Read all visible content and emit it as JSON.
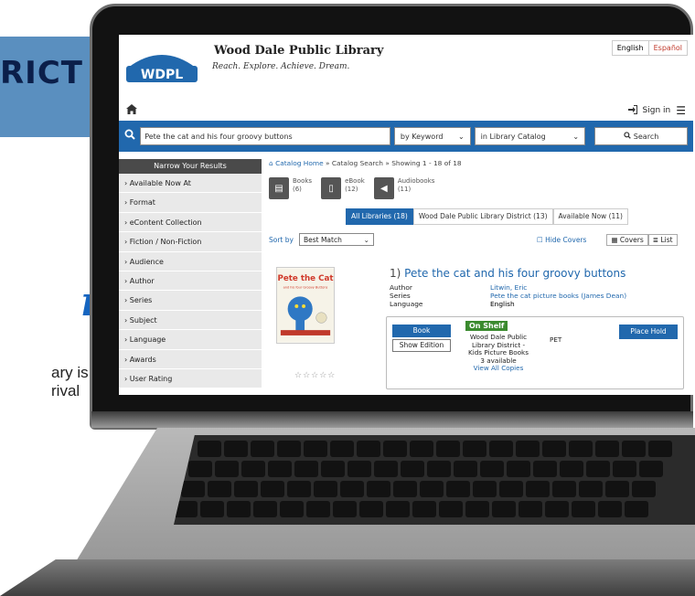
{
  "poster": {
    "banner_text": "RICT",
    "big_italic": "n",
    "line1": "ary is",
    "line2": "rival"
  },
  "library": {
    "logo_text": "WDPL",
    "name": "Wood Dale Public Library",
    "tagline": "Reach. Explore. Achieve. Dream.",
    "lang_en": "English",
    "lang_es": "Español",
    "home_icon": "home-icon",
    "sign_in": "Sign in",
    "menu_icon": "hamburger-icon"
  },
  "search": {
    "query": "Pete the cat and his four groovy buttons",
    "by": "by Keyword",
    "scope": "in Library Catalog",
    "button": "Search"
  },
  "sidebar": {
    "title": "Narrow Your Results",
    "items": [
      "› Available Now At",
      "› Format",
      "› eContent Collection",
      "› Fiction / Non-Fiction",
      "› Audience",
      "› Author",
      "› Series",
      "› Subject",
      "› Language",
      "› Awards",
      "› User Rating"
    ]
  },
  "crumbs": {
    "home": "Catalog Home",
    "sep": " » Catalog Search  » Showing 1 - 18 of 18"
  },
  "formats": [
    {
      "label": "Books",
      "count": "(6)"
    },
    {
      "label": "eBook",
      "count": "(12)"
    },
    {
      "label": "Audiobooks",
      "count": "(11)"
    }
  ],
  "tabs": {
    "all": "All Libraries (18)",
    "district": "Wood Dale Public Library District (13)",
    "avail": "Available Now (11)"
  },
  "sort": {
    "label": "Sort by",
    "value": "Best Match",
    "hide": "Hide Covers",
    "covers": "Covers",
    "list": "List"
  },
  "result": {
    "index": "1)",
    "title": "Pete the cat and his four groovy buttons",
    "author_k": "Author",
    "author_v": "Litwin, Eric",
    "series_k": "Series",
    "series_v": "Pete the cat picture books (James Dean)",
    "lang_k": "Language",
    "lang_v": "English",
    "cover_title": "Pete the Cat",
    "cover_sub": "and his four Groovy Buttons",
    "stars": "☆☆☆☆☆",
    "book_btn": "Book",
    "show_edition": "Show Edition",
    "on_shelf": "On Shelf",
    "lib_line1": "Wood Dale Public",
    "lib_line2": "Library District -",
    "lib_line3": "Kids Picture Books",
    "available": "3 available",
    "view_all": "View All Copies",
    "call_no": "PET",
    "place_hold": "Place Hold"
  },
  "colors": {
    "accent": "#2168ad",
    "on_shelf": "#3a8a2e",
    "sidebar_head": "#4a4a4a"
  }
}
